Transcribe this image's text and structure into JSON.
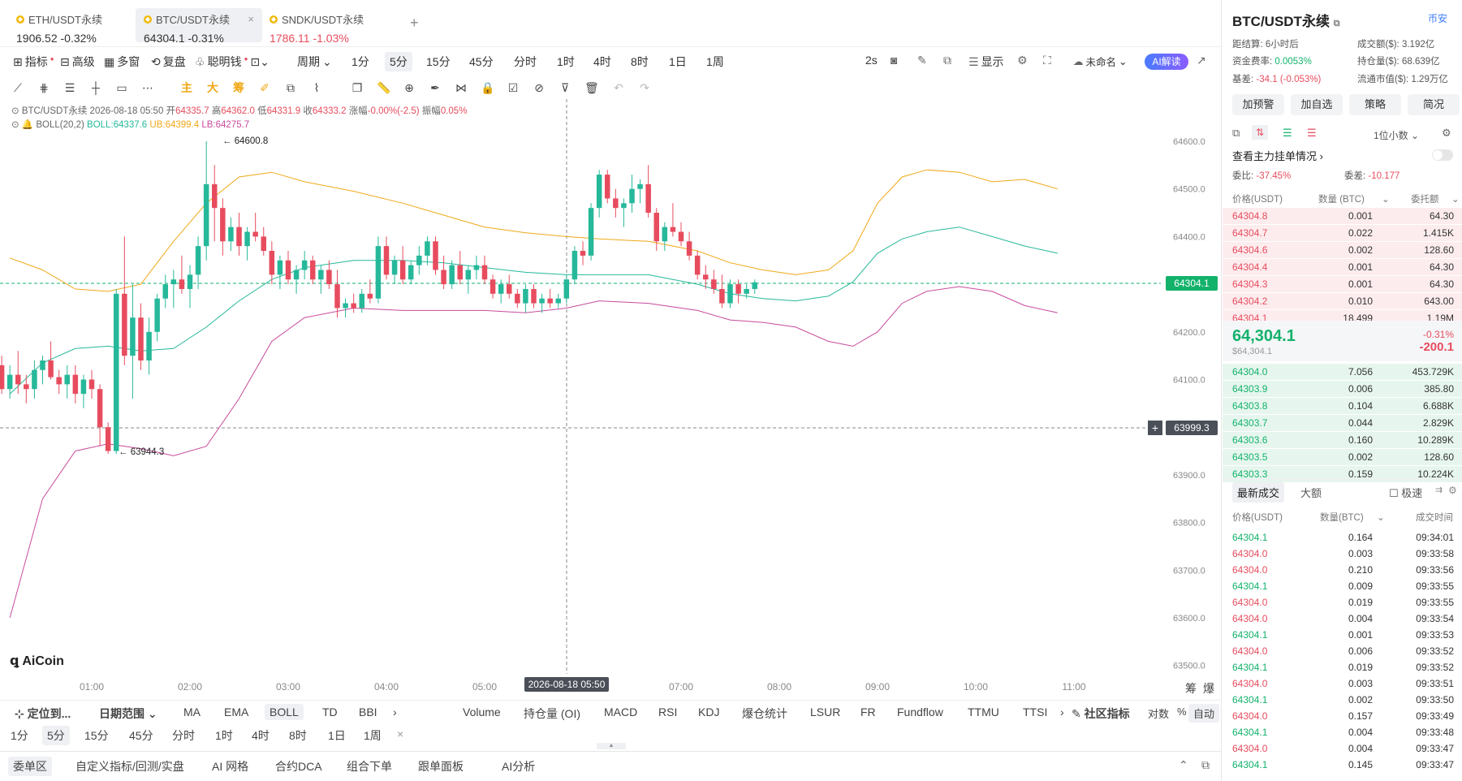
{
  "tabs": [
    {
      "name": "ETH/USDT永续",
      "price": "1906.52",
      "change": "-0.32%",
      "price_color": "#333333"
    },
    {
      "name": "BTC/USDT永续",
      "price": "64304.1",
      "change": "-0.31%",
      "price_color": "#333333"
    },
    {
      "name": "SNDK/USDT永续",
      "price": "1786.11",
      "change": "-1.03%",
      "price_color": "#e74c5e"
    }
  ],
  "add_tab": "+",
  "toolbar": {
    "indicators": "指标",
    "advanced": "高级",
    "multi_window": "多窗",
    "replay": "复盘",
    "smart_money": "聪明钱",
    "period": "周期",
    "periods": [
      "1分",
      "5分",
      "15分",
      "45分",
      "分时",
      "1时",
      "4时",
      "8时",
      "1日",
      "1周"
    ],
    "selected_period": "5分",
    "refresh": "2s",
    "display": "显示",
    "unnamed": "未命名",
    "ai": "AI解读"
  },
  "legend": {
    "line1": {
      "symbol": "BTC/USDT永续",
      "time": "2026-08-18 05:50",
      "open_label": "开",
      "open": "64335.7",
      "high_label": "高",
      "high": "64362.0",
      "low_label": "低",
      "low": "64331.9",
      "close_label": "收",
      "close": "64333.2",
      "chg_label": "涨幅",
      "chg": "-0.00%(-2.5)",
      "amp_label": "振幅",
      "amp": "0.05%"
    },
    "line2": {
      "name": "BOLL(20,2)",
      "boll": "BOLL:64337.6",
      "ub": "UB:64399.4",
      "lb": "LB:64275.7"
    }
  },
  "chart_data": {
    "type": "candlestick",
    "title": "",
    "ylim": [
      63500,
      64600
    ],
    "y_ticks": [
      "64600.0",
      "64500.0",
      "64400.0",
      "64300.0",
      "64200.0",
      "64100.0",
      "64000.0",
      "63900.0",
      "63800.0",
      "63700.0",
      "63600.0",
      "63500.0"
    ],
    "x_ticks": [
      "01:00",
      "02:00",
      "03:00",
      "04:00",
      "05:00",
      "07:00",
      "08:00",
      "09:00",
      "10:00",
      "11:00"
    ],
    "crosshair_time": "2026-08-18 05:50",
    "last_price": "64304.1",
    "cursor_price": "63999.3",
    "high_marker": "64600.8",
    "low_marker": "63944.3",
    "series": [
      {
        "name": "BOLL",
        "color": "#26b89a"
      },
      {
        "name": "UB",
        "color": "#f0a818"
      },
      {
        "name": "LB",
        "color": "#c84a9c"
      }
    ]
  },
  "watermark": "AiCoin",
  "axis_buttons": {
    "chip": "筹",
    "explode": "爆"
  },
  "bottom_bar": {
    "locate": "定位到...",
    "date_range": "日期范围",
    "main_indicators": [
      "MA",
      "EMA",
      "BOLL",
      "TD",
      "BBI"
    ],
    "selected_main": "BOLL",
    "sub_indicators": [
      "Volume",
      "持仓量 (OI)",
      "MACD",
      "RSI",
      "KDJ",
      "爆仓统计",
      "LSUR",
      "FR",
      "Fundflow",
      "TTMU",
      "TTSI"
    ],
    "community": "社区指标",
    "log": "对数",
    "percent": "%",
    "auto": "自动",
    "periods": [
      "1分",
      "5分",
      "15分",
      "45分",
      "分时",
      "1时",
      "4时",
      "8时",
      "1日",
      "1周"
    ],
    "selected_period": "5分",
    "close": "×"
  },
  "footer_tabs": [
    "委单区",
    "自定义指标/回测/实盘",
    "AI 网格",
    "合约DCA",
    "组合下单",
    "跟单面板",
    "AI分析"
  ],
  "right": {
    "title": "BTC/USDT永续",
    "exchange": "币安",
    "settle_label": "距结算:",
    "settle": "6小时后",
    "volume_label": "成交额($):",
    "volume": "3.192亿",
    "funding_label": "资金费率:",
    "funding": "0.0053%",
    "oi_label": "持仓量($):",
    "oi": "68.639亿",
    "basis_label": "基差:",
    "basis": "-34.1 (-0.053%)",
    "mcap_label": "流通市值($):",
    "mcap": "1.29万亿",
    "buttons": [
      "加预警",
      "加自选",
      "策略",
      "简况"
    ],
    "decimals": "1位小数",
    "main_orders": "查看主力挂单情况",
    "ratio_label": "委比:",
    "ratio": "-37.45%",
    "diff_label": "委差:",
    "diff": "-10.177",
    "ob_headers": [
      "价格(USDT)",
      "数量 (BTC)",
      "委托额"
    ],
    "asks": [
      [
        "64304.8",
        "0.001",
        "64.30"
      ],
      [
        "64304.7",
        "0.022",
        "1.415K"
      ],
      [
        "64304.6",
        "0.002",
        "128.60"
      ],
      [
        "64304.4",
        "0.001",
        "64.30"
      ],
      [
        "64304.3",
        "0.001",
        "64.30"
      ],
      [
        "64304.2",
        "0.010",
        "643.00"
      ],
      [
        "64304.1",
        "18.499",
        "1.19M"
      ]
    ],
    "mid_price": "64,304.1",
    "mid_sub": "$64,304.1",
    "mid_pct": "-0.31%",
    "mid_chg": "-200.1",
    "bids": [
      [
        "64304.0",
        "7.056",
        "453.729K"
      ],
      [
        "64303.9",
        "0.006",
        "385.80"
      ],
      [
        "64303.8",
        "0.104",
        "6.688K"
      ],
      [
        "64303.7",
        "0.044",
        "2.829K"
      ],
      [
        "64303.6",
        "0.160",
        "10.289K"
      ],
      [
        "64303.5",
        "0.002",
        "128.60"
      ],
      [
        "64303.3",
        "0.159",
        "10.224K"
      ]
    ],
    "trades_tab": "最新成交",
    "big_tab": "大额",
    "fast": "极速",
    "trade_headers": [
      "价格(USDT)",
      "数量(BTC)",
      "成交时间"
    ],
    "trades": [
      [
        "64304.1",
        "0.164",
        "09:34:01",
        "b"
      ],
      [
        "64304.0",
        "0.003",
        "09:33:58",
        "s"
      ],
      [
        "64304.0",
        "0.210",
        "09:33:56",
        "s"
      ],
      [
        "64304.1",
        "0.009",
        "09:33:55",
        "b"
      ],
      [
        "64304.0",
        "0.019",
        "09:33:55",
        "s"
      ],
      [
        "64304.0",
        "0.004",
        "09:33:54",
        "s"
      ],
      [
        "64304.1",
        "0.001",
        "09:33:53",
        "b"
      ],
      [
        "64304.0",
        "0.006",
        "09:33:52",
        "s"
      ],
      [
        "64304.1",
        "0.019",
        "09:33:52",
        "b"
      ],
      [
        "64304.0",
        "0.003",
        "09:33:51",
        "s"
      ],
      [
        "64304.1",
        "0.002",
        "09:33:50",
        "b"
      ],
      [
        "64304.0",
        "0.157",
        "09:33:49",
        "s"
      ],
      [
        "64304.1",
        "0.004",
        "09:33:48",
        "b"
      ],
      [
        "64304.0",
        "0.004",
        "09:33:47",
        "s"
      ],
      [
        "64304.1",
        "0.145",
        "09:33:47",
        "b"
      ]
    ]
  }
}
